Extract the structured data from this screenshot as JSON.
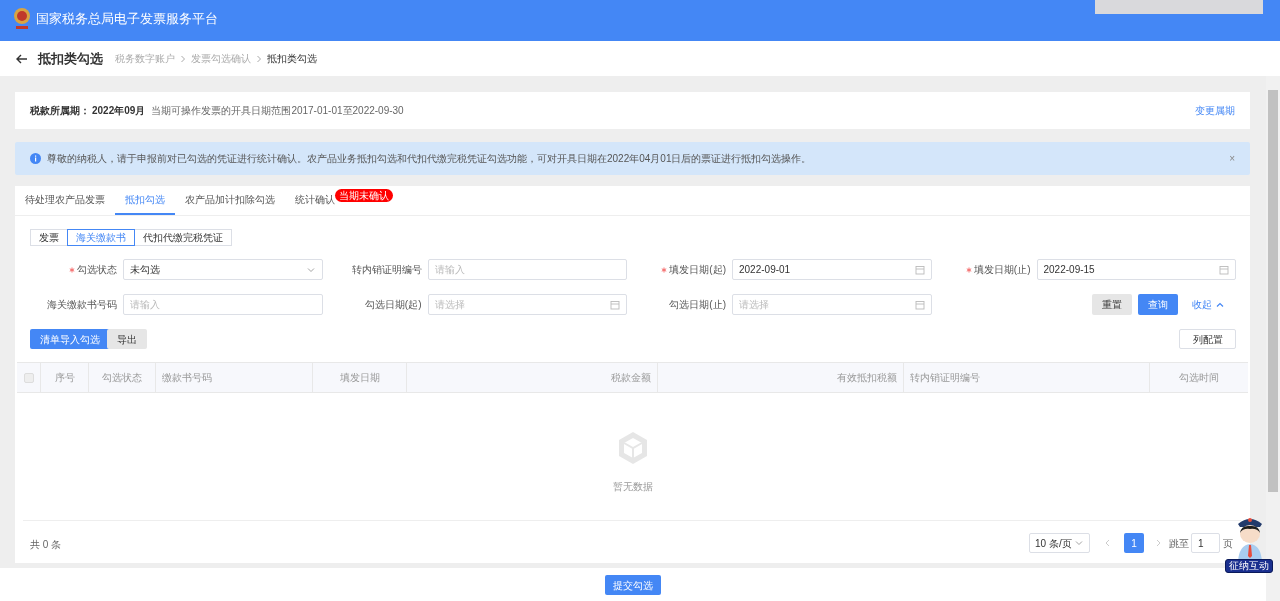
{
  "header": {
    "title": "国家税务总局电子发票服务平台"
  },
  "page": {
    "title": "抵扣类勾选",
    "breadcrumbs": [
      {
        "label": "税务数字账户",
        "current": false
      },
      {
        "label": "发票勾选确认",
        "current": false
      },
      {
        "label": "抵扣类勾选",
        "current": true
      }
    ]
  },
  "period": {
    "label": "税款所属期：",
    "value": "2022年09月",
    "note": "当期可操作发票的开具日期范围2017-01-01至2022-09-30",
    "link": "变更属期"
  },
  "alert": {
    "text": "尊敬的纳税人，请于申报前对已勾选的凭证进行统计确认。农产品业务抵扣勾选和代扣代缴完税凭证勾选功能，可对开具日期在2022年04月01日后的票证进行抵扣勾选操作。",
    "close": "×"
  },
  "tabs": [
    {
      "label": "待处理农产品发票",
      "selected": false
    },
    {
      "label": "抵扣勾选",
      "selected": true
    },
    {
      "label": "农产品加计扣除勾选",
      "selected": false
    },
    {
      "label": "统计确认",
      "selected": false,
      "badge": "当期未确认"
    }
  ],
  "segments": [
    {
      "label": "发票",
      "selected": false
    },
    {
      "label": "海关缴款书",
      "selected": true
    },
    {
      "label": "代扣代缴完税凭证",
      "selected": false
    }
  ],
  "filters": [
    {
      "label": "勾选状态",
      "required": true,
      "kind": "select",
      "value": "未勾选"
    },
    {
      "label": "转内销证明编号",
      "required": false,
      "kind": "text",
      "placeholder": "请输入"
    },
    {
      "label": "填发日期(起)",
      "required": true,
      "kind": "date",
      "value": "2022-09-01"
    },
    {
      "label": "填发日期(止)",
      "required": true,
      "kind": "date",
      "value": "2022-09-15"
    },
    {
      "label": "海关缴款书号码",
      "required": false,
      "kind": "text",
      "placeholder": "请输入"
    },
    {
      "label": "勾选日期(起)",
      "required": false,
      "kind": "date",
      "placeholder": "请选择"
    },
    {
      "label": "勾选日期(止)",
      "required": false,
      "kind": "date",
      "placeholder": "请选择"
    }
  ],
  "filter_actions": {
    "reset": "重置",
    "query": "查询",
    "collapse": "收起"
  },
  "toolbar": {
    "import": "清单导入勾选",
    "export": "导出",
    "columns": "列配置"
  },
  "table": {
    "select_all": {
      "checked": false,
      "disabled": true
    },
    "columns": [
      {
        "label": "序号"
      },
      {
        "label": "勾选状态"
      },
      {
        "label": "缴款书号码"
      },
      {
        "label": "填发日期"
      },
      {
        "label": "税款金额"
      },
      {
        "label": "有效抵扣税额"
      },
      {
        "label": "转内销证明编号"
      },
      {
        "label": "勾选时间"
      }
    ],
    "empty": "暂无数据"
  },
  "pagination": {
    "total": "共 0 条",
    "page_size": "10 条/页",
    "pages": [
      {
        "label": "1",
        "selected": true
      }
    ],
    "jump_label": "跳至",
    "jump_value": "1",
    "jump_suffix": "页"
  },
  "assistant": {
    "label": "征纳互动"
  },
  "footer": {
    "submit": "提交勾选"
  }
}
